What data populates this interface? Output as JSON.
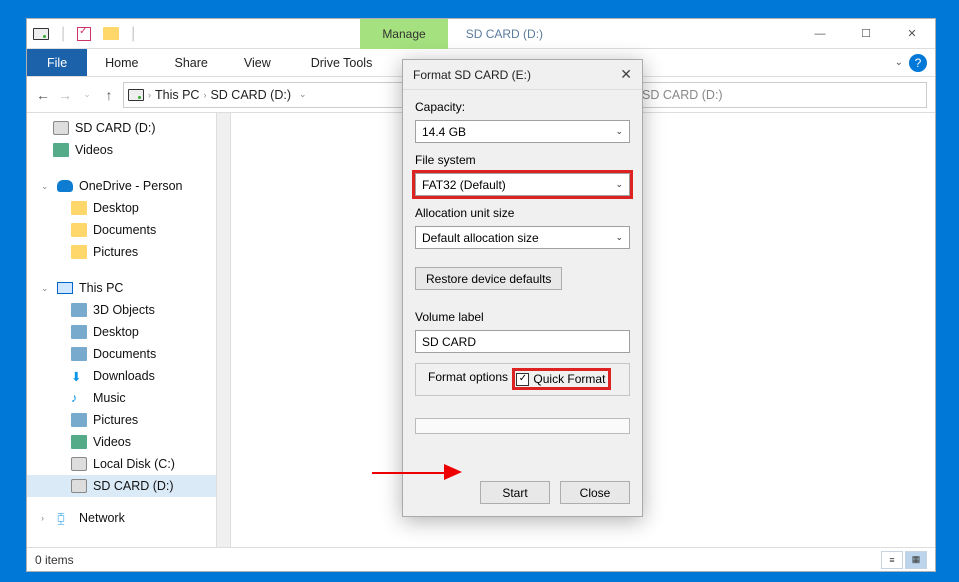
{
  "titlebar": {
    "manage": "Manage",
    "path": "SD CARD (D:)"
  },
  "window_controls": {
    "min": "—",
    "max": "☐",
    "close": "✕"
  },
  "ribbon": {
    "file": "File",
    "home": "Home",
    "share": "Share",
    "view": "View",
    "drive_tools": "Drive Tools"
  },
  "nav": {
    "crumbs": [
      "This PC",
      "SD CARD (D:)"
    ],
    "search_placeholder": "Search SD CARD (D:)"
  },
  "sidebar": {
    "quick": [
      {
        "label": "SD CARD (D:)"
      },
      {
        "label": "Videos"
      }
    ],
    "onedrive": {
      "label": "OneDrive - Person",
      "children": [
        "Desktop",
        "Documents",
        "Pictures"
      ]
    },
    "thispc": {
      "label": "This PC",
      "children": [
        "3D Objects",
        "Desktop",
        "Documents",
        "Downloads",
        "Music",
        "Pictures",
        "Videos",
        "Local Disk (C:)",
        "SD CARD (D:)"
      ]
    },
    "network": {
      "label": "Network"
    }
  },
  "status": {
    "items": "0 items"
  },
  "dialog": {
    "title": "Format SD CARD (E:)",
    "capacity_label": "Capacity:",
    "capacity_value": "14.4 GB",
    "fs_label": "File system",
    "fs_value": "FAT32 (Default)",
    "alloc_label": "Allocation unit size",
    "alloc_value": "Default allocation size",
    "restore": "Restore device defaults",
    "vol_label": "Volume label",
    "vol_value": "SD CARD",
    "fmt_options": "Format options",
    "quick_format": "Quick Format",
    "start": "Start",
    "close": "Close"
  }
}
